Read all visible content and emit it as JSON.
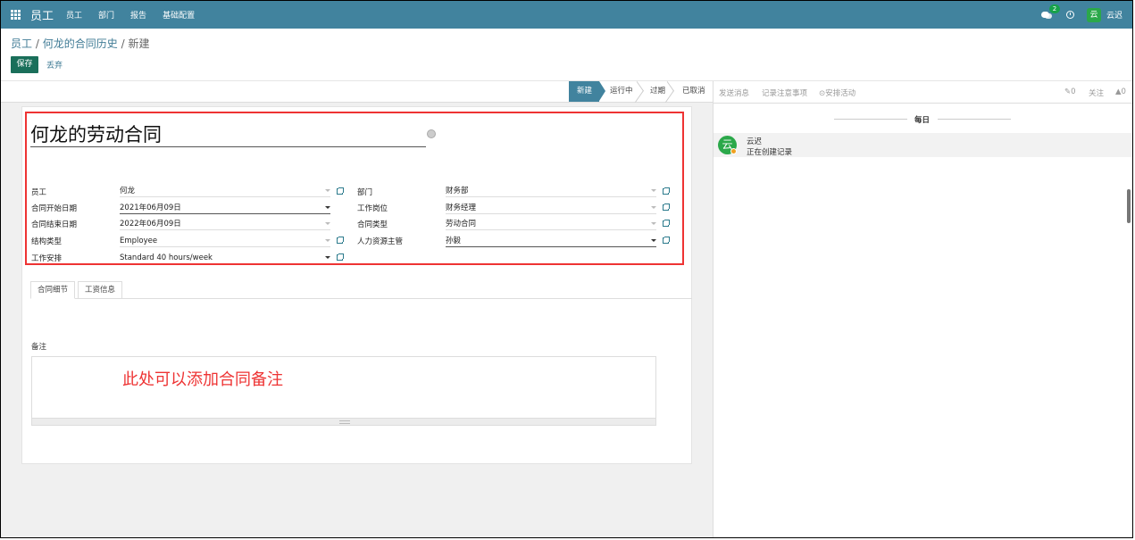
{
  "nav": {
    "app_title": "员工",
    "menu": [
      "员工",
      "部门",
      "报告",
      "基础配置"
    ],
    "message_count": "2",
    "user_initial": "云",
    "user_name": "云迟"
  },
  "breadcrumb": {
    "root": "员工",
    "parent": "何龙的合同历史",
    "current": "新建",
    "sep": "/"
  },
  "buttons": {
    "save": "保存",
    "discard": "丢弃"
  },
  "status_stages": [
    {
      "label": "新建",
      "active": true
    },
    {
      "label": "运行中",
      "active": false
    },
    {
      "label": "过期",
      "active": false
    },
    {
      "label": "已取消",
      "active": false
    }
  ],
  "form": {
    "contract_name": "何龙的劳动合同",
    "left_fields": [
      {
        "label": "员工",
        "value": "何龙"
      },
      {
        "label": "合同开始日期",
        "value": "2021年06月09日"
      },
      {
        "label": "合同结束日期",
        "value": "2022年06月09日"
      },
      {
        "label": "结构类型",
        "value": "Employee"
      },
      {
        "label": "工作安排",
        "value": "Standard 40 hours/week"
      }
    ],
    "right_fields": [
      {
        "label": "部门",
        "value": "财务部"
      },
      {
        "label": "工作岗位",
        "value": "财务经理"
      },
      {
        "label": "合同类型",
        "value": "劳动合同"
      },
      {
        "label": "人力资源主管",
        "value": "孙毅"
      }
    ],
    "tabs": [
      "合同细节",
      "工资信息"
    ],
    "note_label": "备注",
    "note_annotation": "此处可以添加合同备注"
  },
  "chatter": {
    "send_message": "发送消息",
    "log_note": "记录注意事项",
    "schedule_activity": "安排活动",
    "attachments": "0",
    "follow": "关注",
    "followers": "0",
    "day_label": "每日",
    "message": {
      "author": "云迟",
      "author_initial": "云",
      "body": "正在创建记录"
    }
  }
}
